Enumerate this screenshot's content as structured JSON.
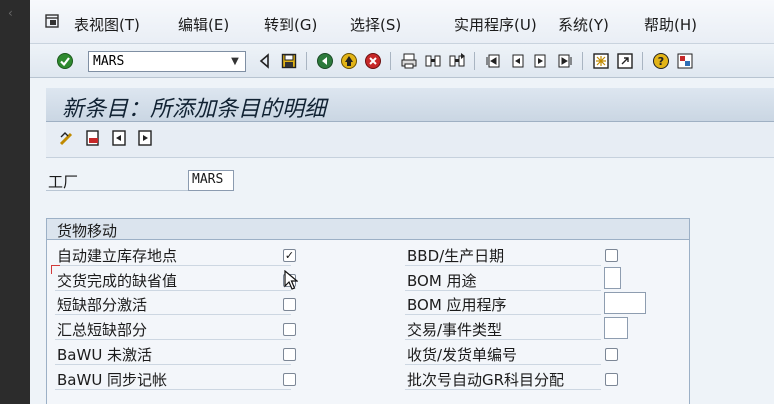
{
  "menubar": {
    "items": [
      "表视图(T)",
      "编辑(E)",
      "转到(G)",
      "选择(S)",
      "实用程序(U)",
      "系统(Y)",
      "帮助(H)"
    ]
  },
  "toolbar": {
    "command_value": "MARS"
  },
  "title": "新条目：所添加条目的明细",
  "plant": {
    "label": "工厂",
    "value": "MARS"
  },
  "group": {
    "title": "货物移动",
    "left_rows": [
      {
        "label": "自动建立库存地点",
        "checked": true
      },
      {
        "label": "交货完成的缺省值",
        "checked": false
      },
      {
        "label": "短缺部分激活",
        "checked": false
      },
      {
        "label": "汇总短缺部分",
        "checked": false
      },
      {
        "label": "BaWU 未激活",
        "checked": false
      },
      {
        "label": "BaWU 同步记帐",
        "checked": false
      }
    ],
    "right_rows": [
      {
        "label": "BBD/生产日期",
        "control": "checkbox",
        "checked": false
      },
      {
        "label": "BOM 用途",
        "control": "input",
        "value": ""
      },
      {
        "label": "BOM 应用程序",
        "control": "input",
        "value": ""
      },
      {
        "label": "交易/事件类型",
        "control": "input",
        "value": ""
      },
      {
        "label": "收货/发货单编号",
        "control": "checkbox",
        "checked": false
      },
      {
        "label": "批次号自动GR科目分配",
        "control": "checkbox",
        "checked": false
      }
    ]
  },
  "check_mark": "✓",
  "colors": {
    "enter_green": "#2f8a2f",
    "save_yellow": "#e2b417",
    "cancel_red": "#c62828",
    "nav_green": "#2c7a3c"
  },
  "icons": [
    "enter-icon",
    "save-icon",
    "back-icon",
    "exit-icon",
    "cancel-icon",
    "print-icon",
    "find-icon",
    "find-next-icon",
    "first-page-icon",
    "previous-page-icon",
    "next-page-icon",
    "last-page-icon",
    "create-session-icon",
    "shortcut-icon",
    "help-icon",
    "customize-layout-icon"
  ]
}
